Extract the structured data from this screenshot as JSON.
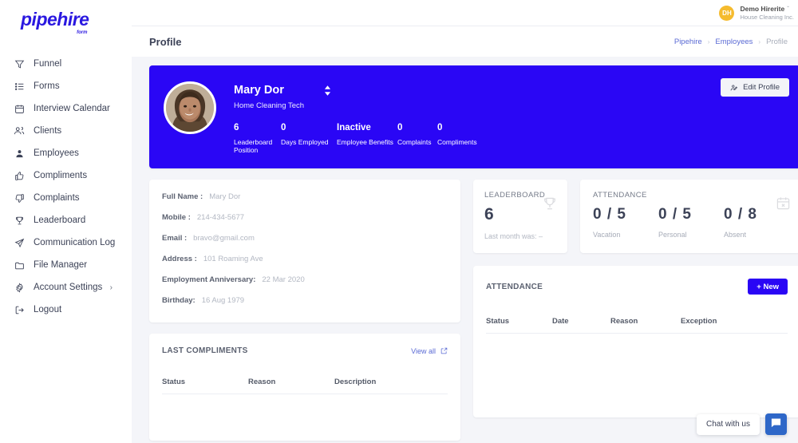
{
  "brand": {
    "name": "pipehire",
    "suffix": "form",
    "color": "#2a18e0"
  },
  "sidebar": {
    "items": [
      {
        "label": "Funnel",
        "icon": "funnel-icon"
      },
      {
        "label": "Forms",
        "icon": "list-icon"
      },
      {
        "label": "Interview Calendar",
        "icon": "calendar-icon"
      },
      {
        "label": "Clients",
        "icon": "users-icon"
      },
      {
        "label": "Employees",
        "icon": "user-icon"
      },
      {
        "label": "Compliments",
        "icon": "thumbs-up-icon"
      },
      {
        "label": "Complaints",
        "icon": "thumbs-down-icon"
      },
      {
        "label": "Leaderboard",
        "icon": "trophy-icon"
      },
      {
        "label": "Communication Log",
        "icon": "send-icon"
      },
      {
        "label": "File Manager",
        "icon": "folder-icon"
      },
      {
        "label": "Account Settings",
        "icon": "gear-icon",
        "chevron": "›"
      },
      {
        "label": "Logout",
        "icon": "logout-icon"
      }
    ]
  },
  "topbar": {
    "avatar_initials": "DH",
    "account_name": "Demo Hirerite",
    "caret": "ˇ",
    "company": "House Cleaning Inc."
  },
  "pagehead": {
    "title": "Profile",
    "breadcrumb": [
      {
        "label": "Pipehire",
        "current": false
      },
      {
        "label": "Employees",
        "current": false
      },
      {
        "label": "Profile",
        "current": true
      }
    ],
    "separator": "›"
  },
  "hero": {
    "name": "Mary Dor",
    "role": "Home Cleaning Tech",
    "edit_button": "Edit Profile",
    "accent_color": "#2a06f5",
    "stats": [
      {
        "value": "6",
        "label": "Leaderboard Position"
      },
      {
        "value": "0",
        "label": "Days Employed"
      },
      {
        "value": "Inactive",
        "label": "Employee Benefits"
      },
      {
        "value": "0",
        "label": "Complaints"
      },
      {
        "value": "0",
        "label": "Compliments"
      }
    ]
  },
  "details": {
    "rows": [
      {
        "label": "Full Name :",
        "value": "Mary Dor"
      },
      {
        "label": "Mobile :",
        "value": "214-434-5677"
      },
      {
        "label": "Email :",
        "value": "bravo@gmail.com"
      },
      {
        "label": "Address :",
        "value": "101 Roaming Ave"
      },
      {
        "label": "Employment Anniversary:",
        "value": "22 Mar 2020"
      },
      {
        "label": "Birthday:",
        "value": "16 Aug 1979"
      }
    ]
  },
  "leaderboard_card": {
    "title": "LEADERBOARD",
    "value": "6",
    "note": "Last month was: –",
    "icon": "trophy-icon"
  },
  "attendance_summary": {
    "title": "ATTENDANCE",
    "icon": "calendar-x-icon",
    "items": [
      {
        "value": "0 / 5",
        "label": "Vacation"
      },
      {
        "value": "0 / 5",
        "label": "Personal"
      },
      {
        "value": "0 / 8",
        "label": "Absent"
      }
    ]
  },
  "attendance_table": {
    "title": "ATTENDANCE",
    "new_button": "+ New",
    "columns": [
      "Status",
      "Date",
      "Reason",
      "Exception"
    ],
    "rows": []
  },
  "compliments_card": {
    "title": "LAST COMPLIMENTS",
    "view_all": "View all",
    "view_all_icon": "external-link-icon",
    "columns": [
      "Status",
      "Reason",
      "Description"
    ],
    "rows": []
  },
  "chat": {
    "label": "Chat with us",
    "icon": "chat-bubble-icon",
    "color": "#2e67c8"
  }
}
